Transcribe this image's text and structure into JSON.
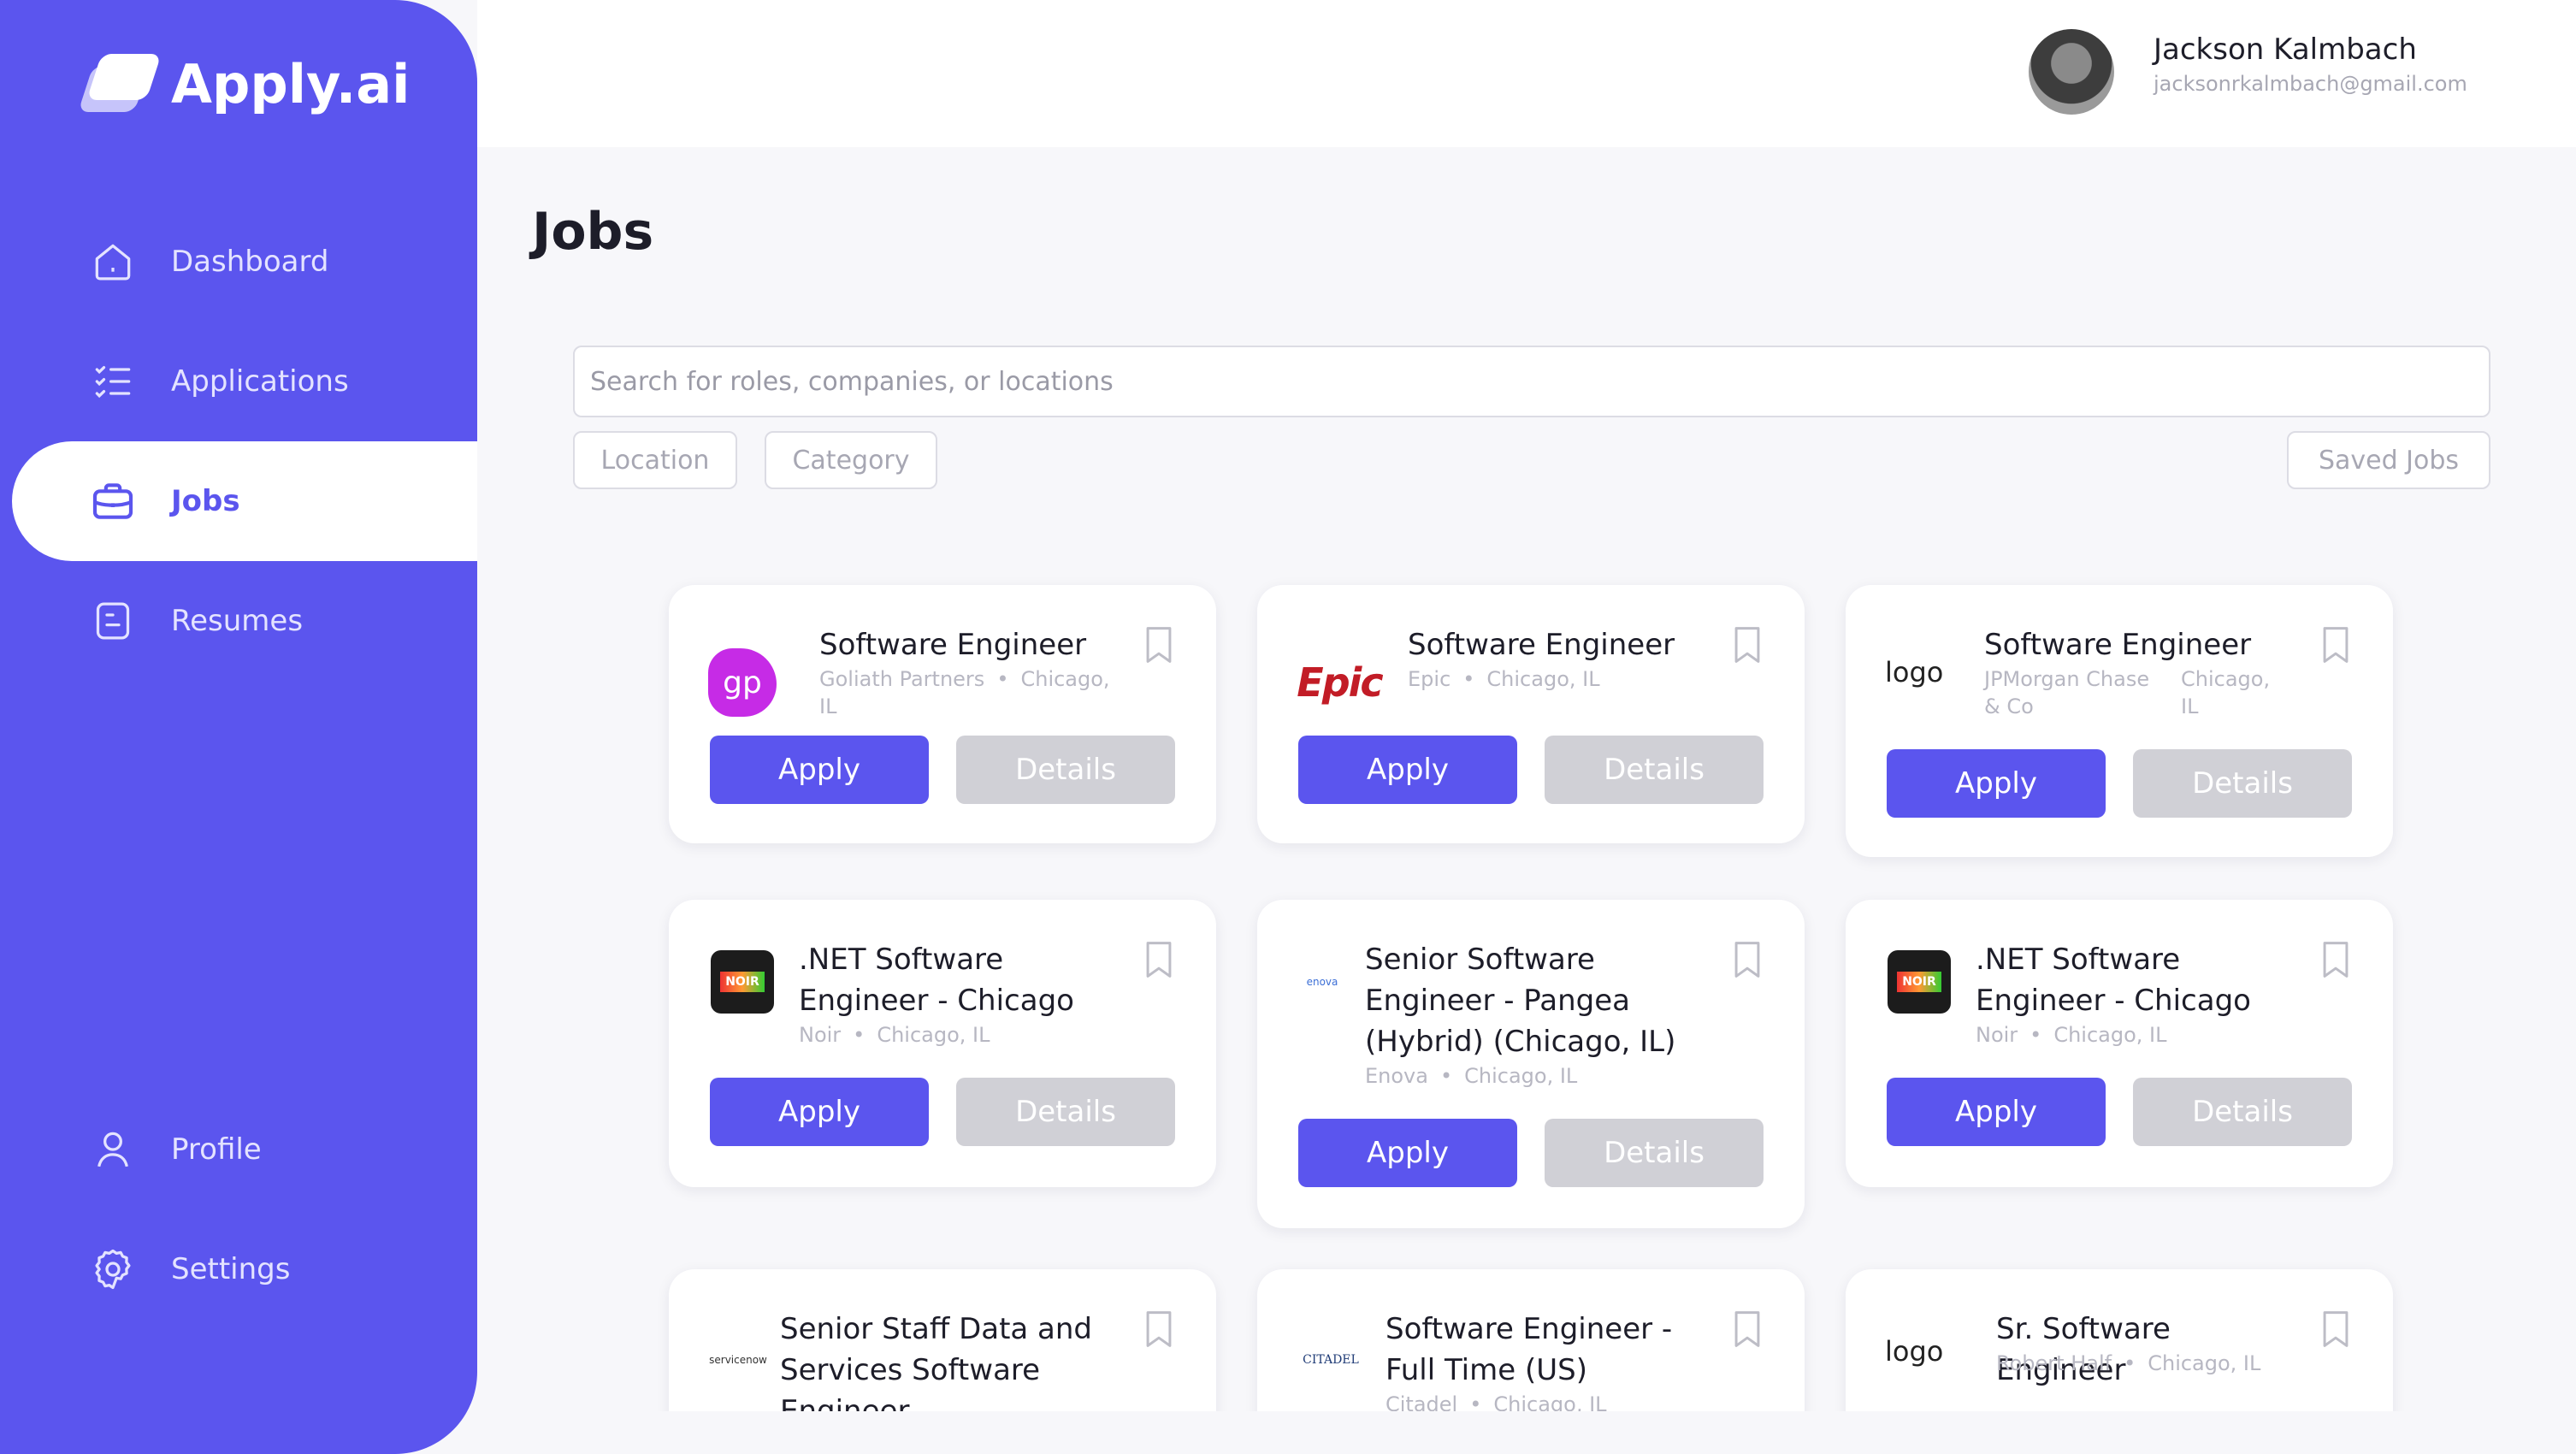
{
  "app": {
    "name": "Apply.ai"
  },
  "nav": {
    "dashboard": "Dashboard",
    "applications": "Applications",
    "jobs": "Jobs",
    "resumes": "Resumes",
    "profile": "Profile",
    "settings": "Settings"
  },
  "user": {
    "name": "Jackson Kalmbach",
    "email": "jacksonrkalmbach@gmail.com"
  },
  "page": {
    "title": "Jobs"
  },
  "search": {
    "placeholder": "Search for roles, companies, or locations"
  },
  "filters": {
    "location": "Location",
    "category": "Category",
    "saved": "Saved Jobs"
  },
  "buttons": {
    "apply": "Apply",
    "details": "Details"
  },
  "jobs": [
    {
      "title": "Software Engineer",
      "company": "Goliath Partners",
      "location": "Chicago, IL",
      "logo_text": "gp"
    },
    {
      "title": "Software Engineer",
      "company": "Epic",
      "location": "Chicago, IL",
      "logo_text": "Epic"
    },
    {
      "title": "Software Engineer",
      "company": "JPMorgan Chase & Co",
      "location": "Chicago, IL",
      "logo_text": "logo"
    },
    {
      "title": ".NET Software Engineer - Chicago",
      "company": "Noir",
      "location": "Chicago, IL",
      "logo_text": "NOIR"
    },
    {
      "title": "Senior Software Engineer - Pangea (Hybrid) (Chicago, IL)",
      "company": "Enova",
      "location": "Chicago, IL",
      "logo_text": "enova"
    },
    {
      "title": ".NET Software Engineer - Chicago",
      "company": "Noir",
      "location": "Chicago, IL",
      "logo_text": "NOIR"
    },
    {
      "title": "Senior Staff Data and Services Software Engineer",
      "company": "",
      "location": "",
      "logo_text": "servicenow"
    },
    {
      "title": "Software Engineer - Full Time (US)",
      "company": "Citadel",
      "location": "Chicago, IL",
      "logo_text": "CITADEL"
    },
    {
      "title": "Sr. Software Engineer",
      "company": "Robert Half",
      "location": "Chicago, IL",
      "logo_text": "logo"
    }
  ],
  "colors": {
    "brand": "#5b55ee",
    "details_button": "#d0d0d6"
  }
}
